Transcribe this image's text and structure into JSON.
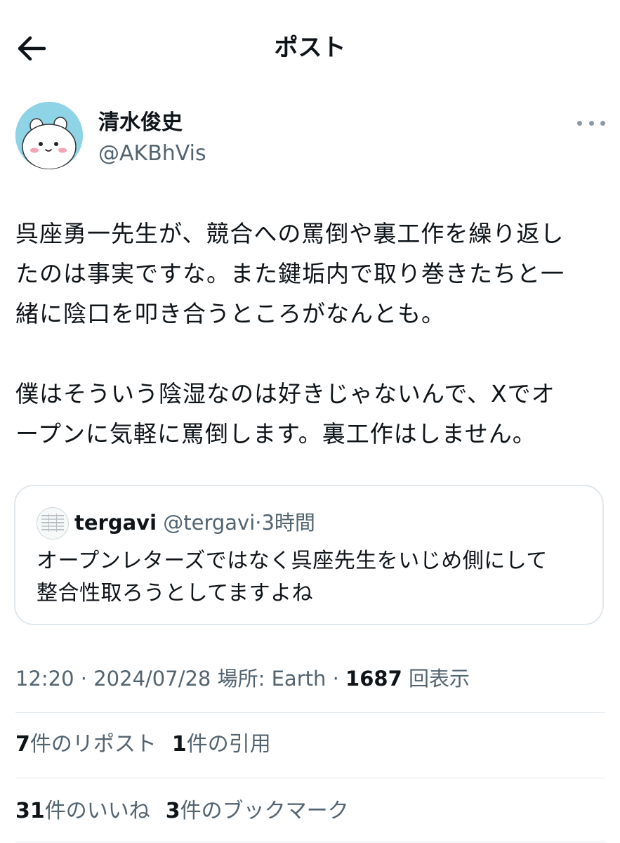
{
  "header": {
    "back_icon": "arrow-left-icon",
    "title": "ポスト"
  },
  "author": {
    "display_name": "清水俊史",
    "handle": "@AKBhVis",
    "more_icon": "more-horizontal-icon"
  },
  "post": {
    "lines": [
      "呉座勇一先生が、競合への罵倒や裏工作を繰り返し",
      "たのは事実ですな。また鍵垢内で取り巻きたちと一",
      "緒に陰口を叩き合うところがなんとも。",
      "",
      "僕はそういう陰湿なのは好きじゃないんで、Xでオ",
      "ープンに気軽に罵倒します。裏工作はしません。"
    ]
  },
  "quote": {
    "name": "tergavi",
    "handle": "@tergavi",
    "separator": "·",
    "time": "3時間",
    "lines": [
      "オープンレターズではなく呉座先生をいじめ側にして",
      "整合性取ろうとしてますよね"
    ]
  },
  "meta": {
    "time": "12:20",
    "sep1": " · ",
    "date": "2024/07/28",
    "location": " 場所: Earth",
    "sep2": " · ",
    "views_count": "1687",
    "views_label": " 回表示"
  },
  "stats": {
    "reposts_count": "7",
    "reposts_label": "件のリポスト",
    "quotes_count": "1",
    "quotes_label": "件の引用",
    "likes_count": "31",
    "likes_label": "件のいいね",
    "bookmarks_count": "3",
    "bookmarks_label": "件のブックマーク"
  },
  "colors": {
    "text": "#0f1419",
    "secondary": "#536471",
    "border": "#e1e8ed",
    "avatar_bg": "#8fd3e6"
  }
}
